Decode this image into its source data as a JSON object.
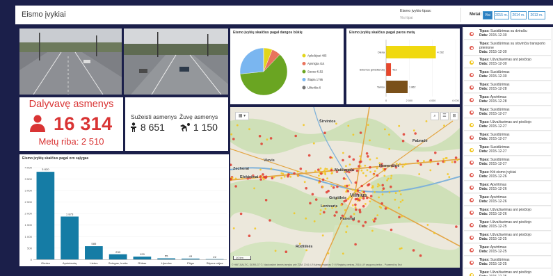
{
  "header": {
    "title": "Eismo įvykiai",
    "filter_label": "Eismo įvykio tipas:",
    "filter_value": "Visi tipai",
    "years_label": "Metai:",
    "years": [
      {
        "label": "Visi",
        "active": true
      },
      {
        "label": "2015 m.",
        "active": false
      },
      {
        "label": "2014 m.",
        "active": false
      },
      {
        "label": "2013 m.",
        "active": false
      }
    ]
  },
  "stats": {
    "people_label": "Dalyvavę asmenys",
    "people_value": "16 314",
    "limit_text": "Metų riba: 2 510",
    "injured_label": "Sužeisti asmenys",
    "injured_value": "8 651",
    "killed_label": "Žuvę asmenys",
    "killed_value": "1 150"
  },
  "pie_chart": {
    "title": "Eismo įvykių skaičius pagal dangos būklę",
    "chart_data": {
      "type": "pie",
      "slices": [
        {
          "label": "Apledėjusi",
          "value": 405,
          "color": "#e2d51a"
        },
        {
          "label": "Apsnigta",
          "value": 414,
          "color": "#e9735c"
        },
        {
          "label": "Sausa",
          "value": 4152,
          "color": "#6aa522"
        },
        {
          "label": "Šlapia",
          "value": 1795,
          "color": "#7ab6f0"
        },
        {
          "label": "Užteršta",
          "value": 6,
          "color": "#757575"
        }
      ]
    }
  },
  "time_chart": {
    "title": "Eismo įvykių skaičius pagal paros metą",
    "chart_data": {
      "type": "bar",
      "orientation": "horizontal",
      "categories": [
        "Diena",
        "Sutemos (prieblanda)",
        "Tamsu"
      ],
      "values": [
        4292,
        423,
        1862
      ],
      "colors": [
        "#f0d90f",
        "#e8472c",
        "#7a5019"
      ],
      "xlim": [
        0,
        6000
      ],
      "xticks": [
        "0",
        "2 000",
        "4 000",
        "6 000"
      ]
    }
  },
  "cond_chart": {
    "title": "Eismo įvykių skaičius pagal oro sąlygas",
    "chart_data": {
      "type": "bar",
      "categories": [
        "Giedra",
        "Apsiniaukę",
        "Lietus",
        "Sniegas, kruša",
        "Rūkas",
        "Lijundra",
        "Pūga",
        "Stiprus vėjas"
      ],
      "values": [
        3820,
        1873,
        585,
        233,
        129,
        55,
        43,
        22
      ],
      "value_labels": [
        "3 820",
        "1 873",
        "585",
        "233",
        "129",
        "55",
        "43",
        "22"
      ],
      "ylim": [
        0,
        4000
      ],
      "yticks": [
        "0",
        "500",
        "1 000",
        "1 500",
        "2 000",
        "2 500",
        "3 000",
        "3 500",
        "4 000"
      ],
      "color": "#157ca5"
    }
  },
  "map": {
    "labels": {
      "vilnius": "Vilnius",
      "grigiskes": "Grigiškės",
      "lentvaris": "Lentvaris",
      "paneriai": "Paneriai",
      "elektrenai": "Elektrėnai",
      "vievis": "Vievis",
      "zarasai": "Zechorai",
      "rudiskes": "Rūdiškės",
      "nemencine": "Nemenčinė",
      "pabrade": "Pabradė",
      "sirvintos": "Širvintos",
      "maisiagala": "Maišiagala"
    },
    "scale": "10 km",
    "attribution": "© HNIT-BALTIC, GDR/LGT ©, Nacionalinė žemės tarnyba prie ŽŪM, 2016; LR Adresų registras © VĮ Registrų centras, 2016; LR saugomų teritor... Powered by Esri"
  },
  "events": [
    {
      "type_label": "Tipas:",
      "type": "Susidūrimas su dviračiu",
      "date_label": "Data:",
      "date": "2015-12-30",
      "color": "#e0584e"
    },
    {
      "type_label": "Tipas:",
      "type": "Susidūrimas su stovinčia transporto priemone",
      "date_label": "Data:",
      "date": "2015-12-30",
      "color": "#e0584e"
    },
    {
      "type_label": "Tipas:",
      "type": "Užvažiavimas ant pėsčiojo",
      "date_label": "Data:",
      "date": "2015-12-30",
      "color": "#f0c419"
    },
    {
      "type_label": "Tipas:",
      "type": "Susidūrimas",
      "date_label": "Data:",
      "date": "2015-12-30",
      "color": "#e0584e"
    },
    {
      "type_label": "Tipas:",
      "type": "Susidūrimas",
      "date_label": "Data:",
      "date": "2015-12-28",
      "color": "#e0584e"
    },
    {
      "type_label": "Tipas:",
      "type": "Apvirtimas",
      "date_label": "Data:",
      "date": "2015-12-28",
      "color": "#e0584e"
    },
    {
      "type_label": "Tipas:",
      "type": "Susidūrimas",
      "date_label": "Data:",
      "date": "2015-12-27",
      "color": "#e0584e"
    },
    {
      "type_label": "Tipas:",
      "type": "Užvažiavimas ant pėsčiojo",
      "date_label": "Data:",
      "date": "2015-12-27",
      "color": "#f0c419"
    },
    {
      "type_label": "Tipas:",
      "type": "Susidūrimas",
      "date_label": "Data:",
      "date": "2015-12-27",
      "color": "#e0584e"
    },
    {
      "type_label": "Tipas:",
      "type": "Susidūrimas",
      "date_label": "Data:",
      "date": "2015-12-27",
      "color": "#f0c419"
    },
    {
      "type_label": "Tipas:",
      "type": "Susidūrimas",
      "date_label": "Data:",
      "date": "2015-12-27",
      "color": "#e0584e"
    },
    {
      "type_label": "Tipas:",
      "type": "Kiti eismo įvykiai",
      "date_label": "Data:",
      "date": "2015-12-26",
      "color": "#e0584e"
    },
    {
      "type_label": "Tipas:",
      "type": "Apvirtimas",
      "date_label": "Data:",
      "date": "2015-12-26",
      "color": "#e0584e"
    },
    {
      "type_label": "Tipas:",
      "type": "Apvirtimas",
      "date_label": "Data:",
      "date": "2015-12-26",
      "color": "#e0584e"
    },
    {
      "type_label": "Tipas:",
      "type": "Užvažiavimas ant pėsčiojo",
      "date_label": "Data:",
      "date": "2015-12-26",
      "color": "#e0584e"
    },
    {
      "type_label": "Tipas:",
      "type": "Užvažiavimas ant pėsčiojo",
      "date_label": "Data:",
      "date": "2015-12-25",
      "color": "#e0584e"
    },
    {
      "type_label": "Tipas:",
      "type": "Užvažiavimas ant pėsčiojo",
      "date_label": "Data:",
      "date": "2015-12-25",
      "color": "#e0584e"
    },
    {
      "type_label": "Tipas:",
      "type": "Apvirtimas",
      "date_label": "Data:",
      "date": "2015-12-25",
      "color": "#e0584e"
    },
    {
      "type_label": "Tipas:",
      "type": "Susidūrimas",
      "date_label": "Data:",
      "date": "2015-12-25",
      "color": "#e0584e"
    },
    {
      "type_label": "Tipas:",
      "type": "Užvažiavimas ant pėsčiojo",
      "date_label": "Data:",
      "date": "2015-12-25",
      "color": "#f0c419"
    }
  ]
}
